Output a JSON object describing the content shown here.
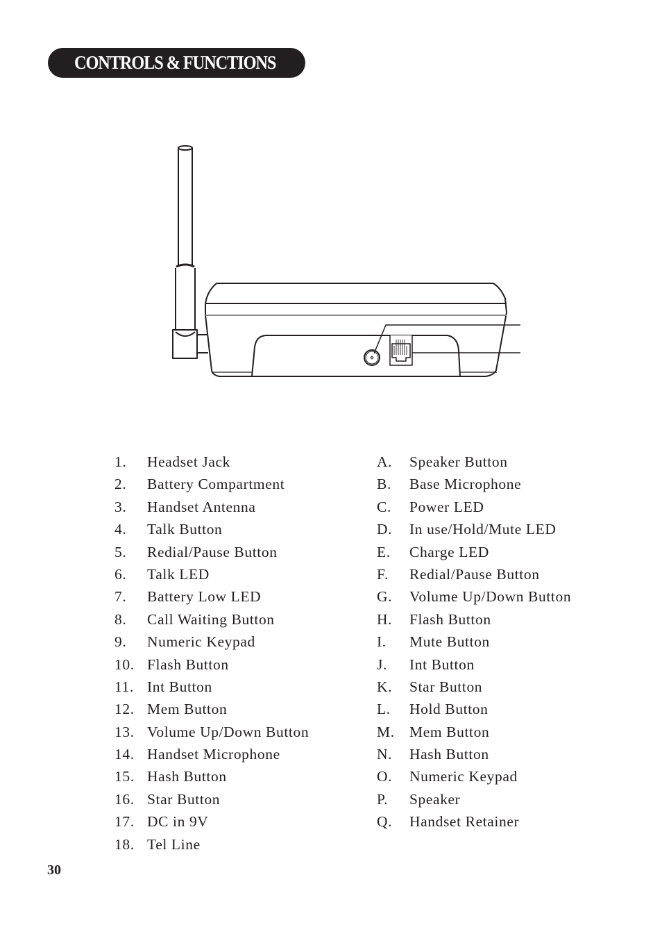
{
  "header": {
    "title": "CONTROLS & FUNCTIONS"
  },
  "colors": {
    "ink": "#231f20",
    "paper": "#ffffff"
  },
  "figure": {
    "description": "Rear view of telephone base unit with antenna, DC power jack and telephone line socket",
    "parts": [
      "antenna",
      "base-body",
      "dc-jack",
      "tel-line-socket",
      "callout-lines"
    ]
  },
  "handset_items": [
    {
      "key": "1.",
      "label": "Headset Jack"
    },
    {
      "key": "2.",
      "label": "Battery Compartment"
    },
    {
      "key": "3.",
      "label": "Handset Antenna"
    },
    {
      "key": "4.",
      "label": "Talk Button"
    },
    {
      "key": "5.",
      "label": "Redial/Pause Button"
    },
    {
      "key": "6.",
      "label": "Talk LED"
    },
    {
      "key": "7.",
      "label": "Battery Low LED"
    },
    {
      "key": "8.",
      "label": "Call Waiting Button"
    },
    {
      "key": "9.",
      "label": "Numeric Keypad"
    },
    {
      "key": "10.",
      "label": "Flash Button"
    },
    {
      "key": "11.",
      "label": "Int Button"
    },
    {
      "key": "12.",
      "label": "Mem Button"
    },
    {
      "key": "13.",
      "label": "Volume Up/Down Button"
    },
    {
      "key": "14.",
      "label": "Handset Microphone"
    },
    {
      "key": "15.",
      "label": "Hash Button"
    },
    {
      "key": "16.",
      "label": "Star Button"
    },
    {
      "key": "17.",
      "label": "DC in 9V"
    },
    {
      "key": "18.",
      "label": "Tel Line"
    }
  ],
  "base_items": [
    {
      "key": "A.",
      "label": "Speaker Button"
    },
    {
      "key": "B.",
      "label": "Base Microphone"
    },
    {
      "key": "C.",
      "label": "Power LED"
    },
    {
      "key": "D.",
      "label": "In use/Hold/Mute LED"
    },
    {
      "key": "E.",
      "label": "Charge LED"
    },
    {
      "key": "F.",
      "label": "Redial/Pause Button"
    },
    {
      "key": "G.",
      "label": "Volume Up/Down Button"
    },
    {
      "key": "H.",
      "label": "Flash Button"
    },
    {
      "key": "I.",
      "label": "Mute Button"
    },
    {
      "key": "J.",
      "label": "Int Button"
    },
    {
      "key": "K.",
      "label": "Star Button"
    },
    {
      "key": "L.",
      "label": "Hold Button"
    },
    {
      "key": "M.",
      "label": "Mem Button"
    },
    {
      "key": "N.",
      "label": "Hash Button"
    },
    {
      "key": "O.",
      "label": "Numeric Keypad"
    },
    {
      "key": "P.",
      "label": "Speaker"
    },
    {
      "key": "Q.",
      "label": "Handset Retainer"
    }
  ],
  "footer": {
    "page_number": "30"
  }
}
